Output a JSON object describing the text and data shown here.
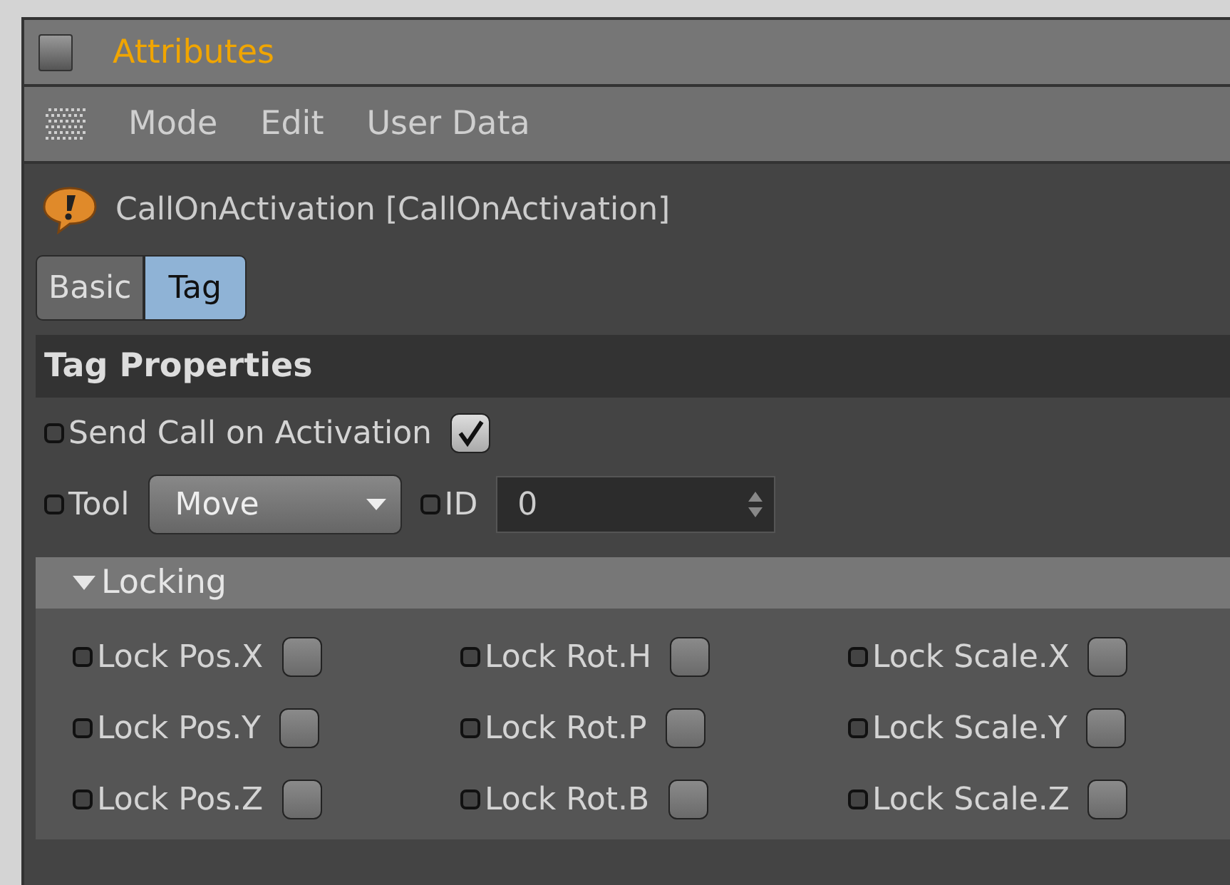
{
  "window": {
    "title": "Attributes"
  },
  "menu": [
    "Mode",
    "Edit",
    "User Data"
  ],
  "object": {
    "name": "CallOnActivation [CallOnActivation]"
  },
  "tabs": [
    {
      "label": "Basic",
      "selected": false
    },
    {
      "label": "Tag",
      "selected": true
    }
  ],
  "section": {
    "title": "Tag Properties"
  },
  "send_call": {
    "label": "Send Call on Activation",
    "checked": true
  },
  "tool": {
    "label": "Tool",
    "value": "Move"
  },
  "id_field": {
    "label": "ID",
    "value": "0"
  },
  "locking": {
    "label": "Locking",
    "expanded": true,
    "items": [
      {
        "label": "Lock Pos.X",
        "checked": false
      },
      {
        "label": "Lock Rot.H",
        "checked": false
      },
      {
        "label": "Lock Scale.X",
        "checked": false
      },
      {
        "label": "Lock Pos.Y",
        "checked": false
      },
      {
        "label": "Lock Rot.P",
        "checked": false
      },
      {
        "label": "Lock Scale.Y",
        "checked": false
      },
      {
        "label": "Lock Pos.Z",
        "checked": false
      },
      {
        "label": "Lock Rot.B",
        "checked": false
      },
      {
        "label": "Lock Scale.Z",
        "checked": false
      }
    ]
  }
}
